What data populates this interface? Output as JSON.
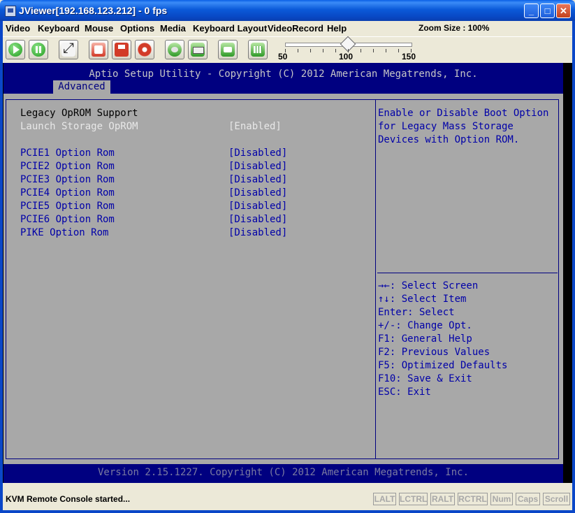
{
  "window": {
    "title": "JViewer[192.168.123.212] - 0 fps"
  },
  "menu": {
    "items": [
      "Video",
      "Keyboard",
      "Mouse",
      "Options",
      "Media",
      "Keyboard Layout",
      "VideoRecord",
      "Help"
    ],
    "zoom": "Zoom Size : 100%"
  },
  "toolbar": {
    "slider_labels": [
      "50",
      "100",
      "150"
    ],
    "zoom_value": 100
  },
  "bios": {
    "header": "Aptio Setup Utility - Copyright (C) 2012 American Megatrends, Inc.",
    "tab": "Advanced",
    "section_title": "Legacy OpROM Support",
    "items": [
      {
        "label": "Launch Storage OpROM",
        "value": "[Enabled]"
      },
      {
        "label": "PCIE1 Option Rom",
        "value": "[Disabled]"
      },
      {
        "label": "PCIE2 Option Rom",
        "value": "[Disabled]"
      },
      {
        "label": "PCIE3 Option Rom",
        "value": "[Disabled]"
      },
      {
        "label": "PCIE4 Option Rom",
        "value": "[Disabled]"
      },
      {
        "label": "PCIE5 Option Rom",
        "value": "[Disabled]"
      },
      {
        "label": "PCIE6 Option Rom",
        "value": "[Disabled]"
      },
      {
        "label": "PIKE Option Rom",
        "value": "[Disabled]"
      }
    ],
    "help_lines": [
      "Enable or Disable Boot Option",
      "for Legacy Mass Storage",
      "Devices with Option ROM."
    ],
    "keys": [
      "→←: Select Screen",
      "↑↓: Select Item",
      "Enter: Select",
      "+/-: Change Opt.",
      "F1: General Help",
      "F2: Previous Values",
      "F5: Optimized Defaults",
      "F10: Save & Exit",
      "ESC: Exit"
    ],
    "footer": "Version 2.15.1227. Copyright (C) 2012 American Megatrends, Inc."
  },
  "status": {
    "text": "KVM Remote Console started...",
    "keys": [
      "LALT",
      "LCTRL",
      "RALT",
      "RCTRL",
      "Num",
      "Caps",
      "Scroll"
    ]
  },
  "colors": {
    "bios_blue": "#000080",
    "bios_gray": "#a8a8a8",
    "titlebar_blue": "#0a5fe6"
  }
}
